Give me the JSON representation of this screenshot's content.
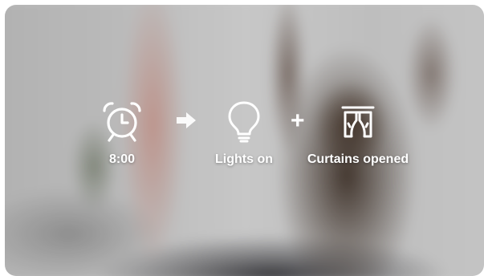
{
  "scene": {
    "alarm": {
      "icon": "alarm-clock-icon",
      "label": "8:00"
    },
    "arrow": {
      "icon": "arrow-right-icon"
    },
    "lights": {
      "icon": "light-bulb-icon",
      "label": "Lights on"
    },
    "plus": {
      "icon": "plus-icon",
      "symbol": "+"
    },
    "curtains": {
      "icon": "curtains-icon",
      "label": "Curtains opened"
    }
  },
  "colors": {
    "text": "#ffffff"
  }
}
